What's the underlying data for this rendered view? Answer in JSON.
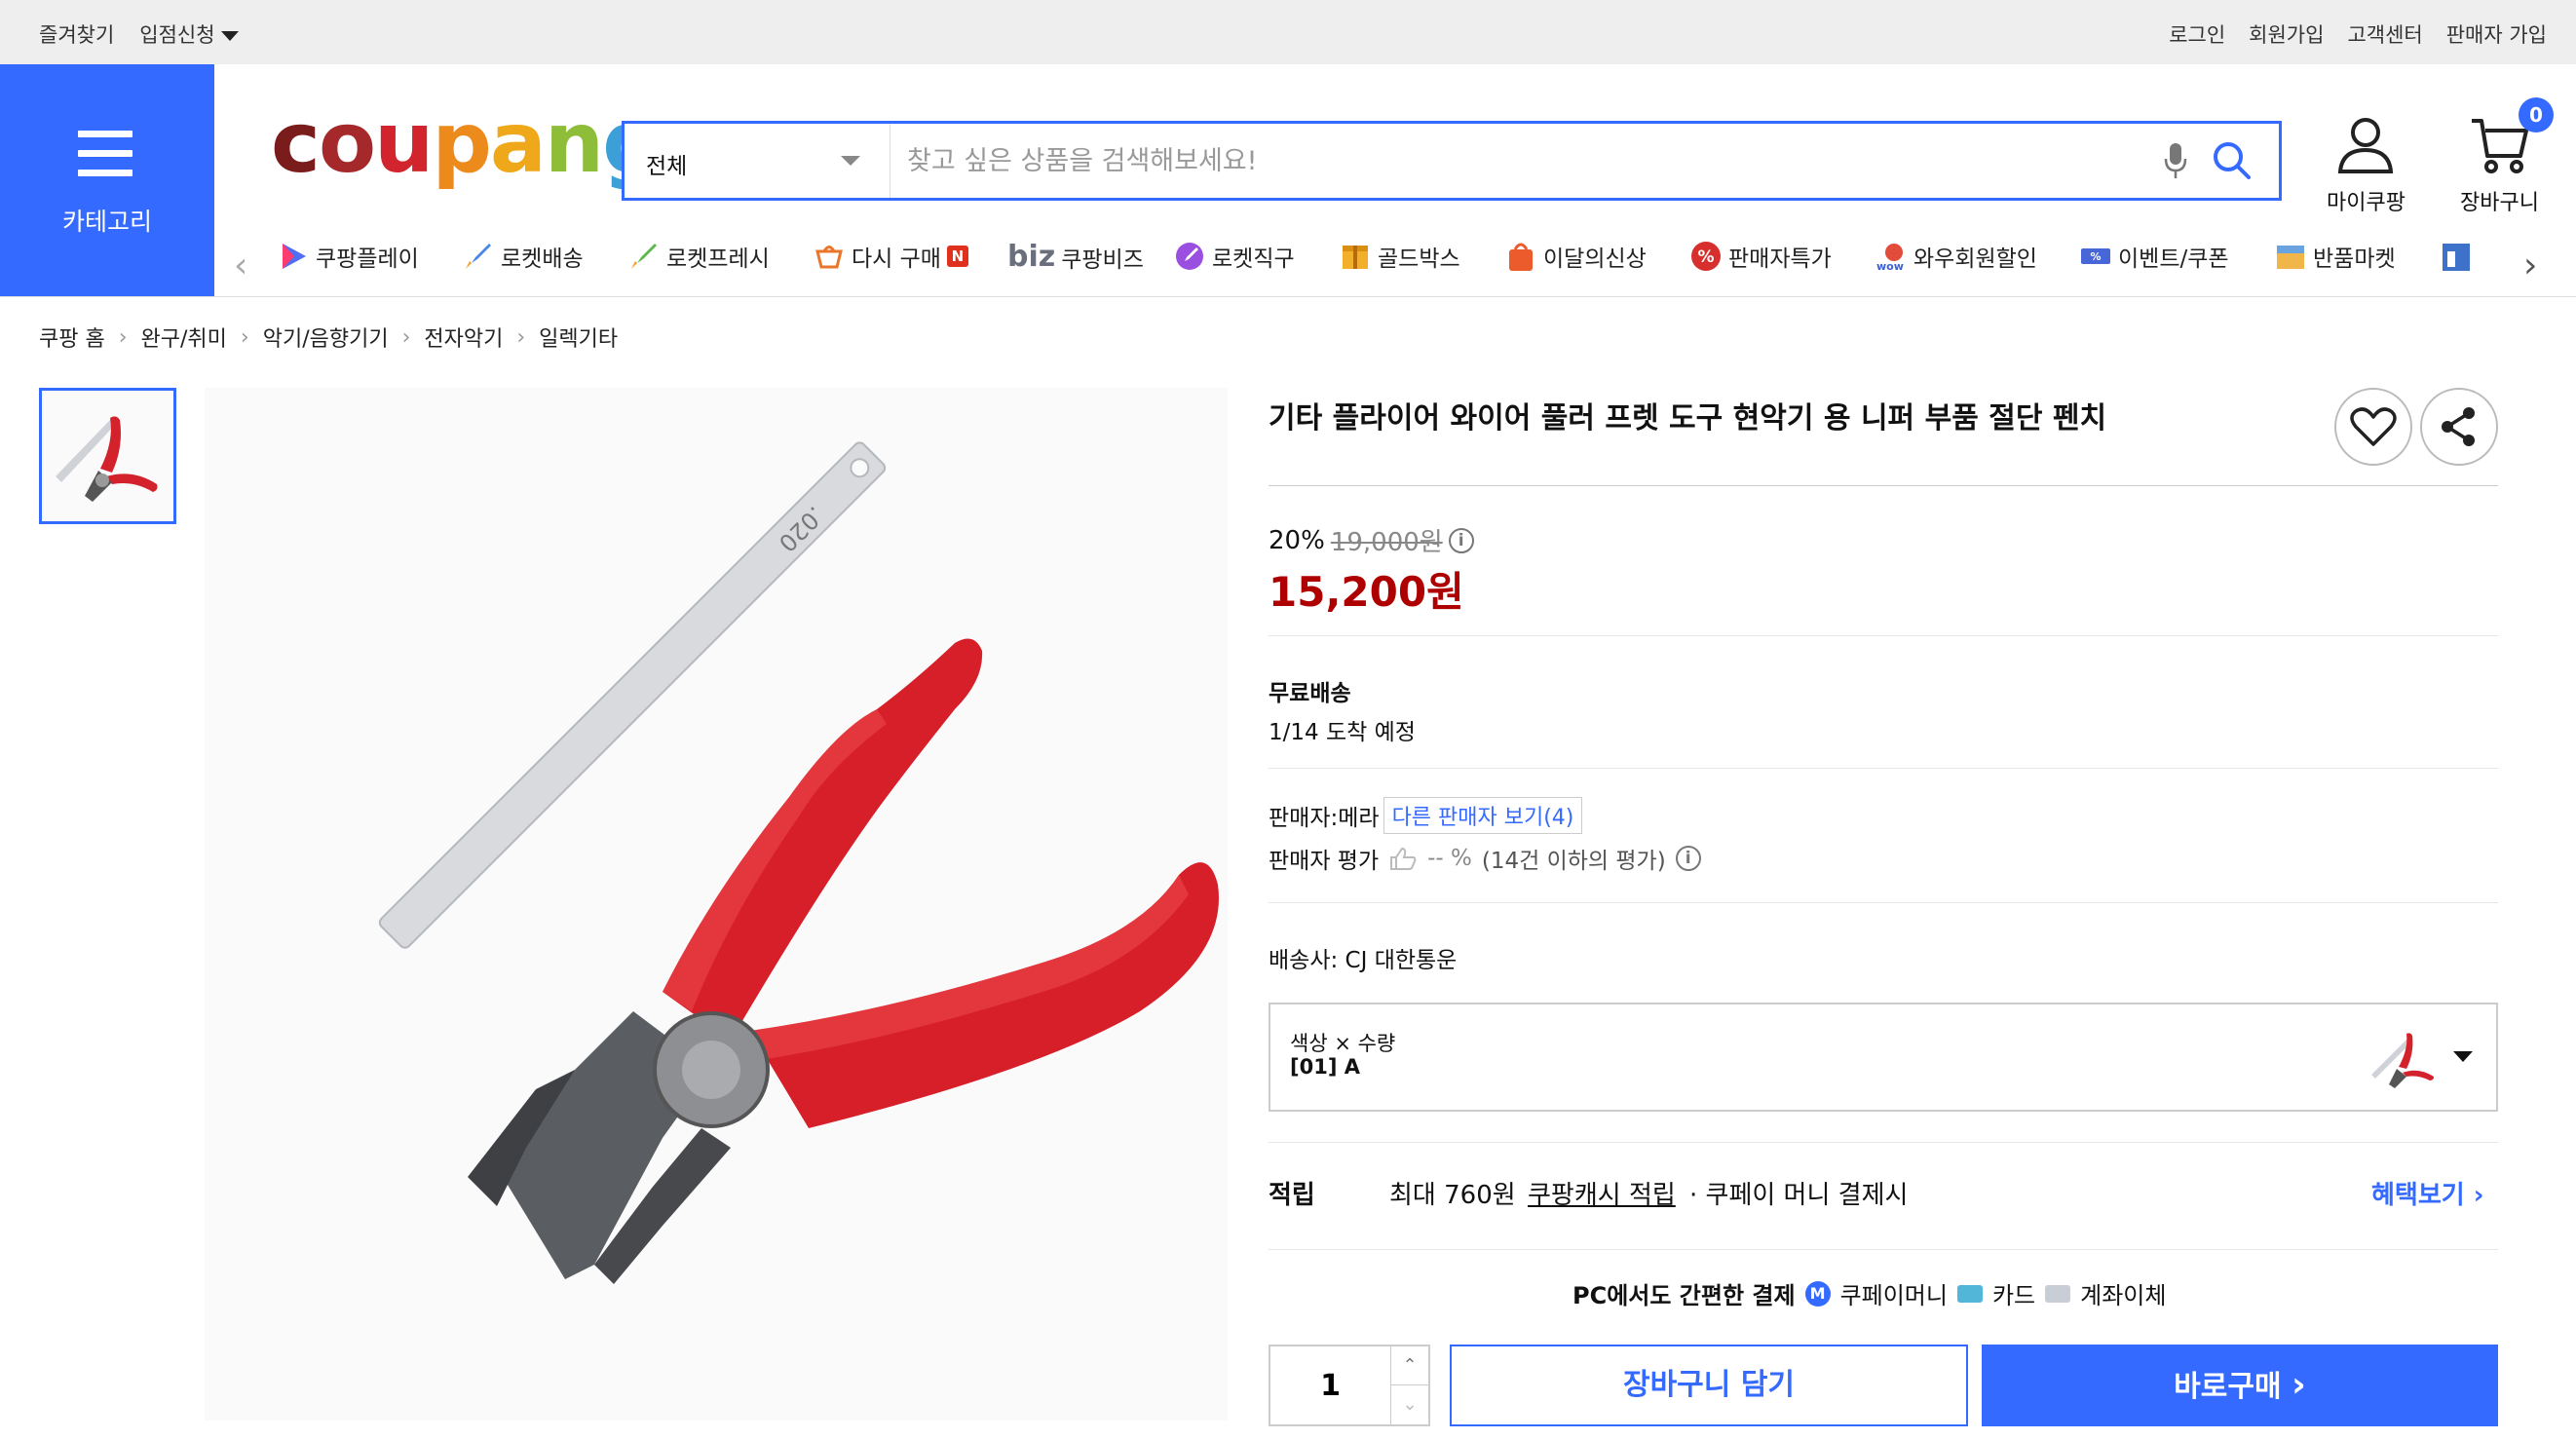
{
  "topbar": {
    "favorites": "즐겨찾기",
    "vendor_apply": "입점신청",
    "login": "로그인",
    "signup": "회원가입",
    "customer_center": "고객센터",
    "seller_signup": "판매자 가입"
  },
  "category_button": "카테고리",
  "logo": [
    "c",
    "o",
    "u",
    "p",
    "a",
    "n",
    "g"
  ],
  "search": {
    "category": "전체",
    "placeholder": "찾고 싶은 상품을 검색해보세요!"
  },
  "header_links": {
    "my_coupang": "마이쿠팡",
    "cart": "장바구니",
    "cart_count": "0"
  },
  "nav": [
    {
      "label": "쿠팡플레이",
      "icon": "play-icon"
    },
    {
      "label": "로켓배송",
      "icon": "rocket-icon"
    },
    {
      "label": "로켓프레시",
      "icon": "fresh-rocket-icon"
    },
    {
      "label": "다시 구매",
      "icon": "rebuy-icon"
    },
    {
      "label": "쿠팡비즈",
      "prefix": "biz",
      "icon": "biz-icon"
    },
    {
      "label": "로켓직구",
      "icon": "global-rocket-icon"
    },
    {
      "label": "골드박스",
      "icon": "goldbox-icon"
    },
    {
      "label": "이달의신상",
      "icon": "new-bag-icon"
    },
    {
      "label": "판매자특가",
      "icon": "percent-icon"
    },
    {
      "label": "와우회원할인",
      "icon": "wow-icon"
    },
    {
      "label": "이벤트/쿠폰",
      "icon": "coupon-icon"
    },
    {
      "label": "반품마켓",
      "icon": "sale-market-icon"
    }
  ],
  "breadcrumb": [
    "쿠팡 홈",
    "완구/취미",
    "악기/음향기기",
    "전자악기",
    "일렉기타"
  ],
  "product": {
    "title": "기타 플라이어 와이어 풀러 프렛 도구 현악기 용 니퍼 부품 절단 펜치",
    "discount_rate": "20%",
    "original_price": "19,000원",
    "price": "15,200원",
    "shipping_label": "무료배송",
    "arrival": "1/14 도착 예정",
    "seller_label": "판매자:메라",
    "other_sellers": "다른 판매자 보기(4)",
    "seller_rating_label": "판매자 평가",
    "seller_rating_value": "-- %",
    "seller_rating_note": "(14건 이하의 평가)",
    "carrier": "배송사:  CJ 대한통운",
    "option_title": "색상 × 수량",
    "option_value": "[01] A",
    "points_label": "적립",
    "points_max": "최대 760원",
    "points_cash": "쿠팡캐시 적립",
    "points_cond": "· 쿠페이 머니 결제시",
    "benefits": "혜택보기",
    "pc_pay": "PC에서도 간편한 결제",
    "pay_money": "쿠페이머니",
    "pay_card": "카드",
    "pay_account": "계좌이체",
    "quantity": "1",
    "add_to_cart": "장바구니 담기",
    "buy_now": "바로구매"
  },
  "colors": {
    "accent": "#346aff",
    "price": "#ae0000"
  }
}
